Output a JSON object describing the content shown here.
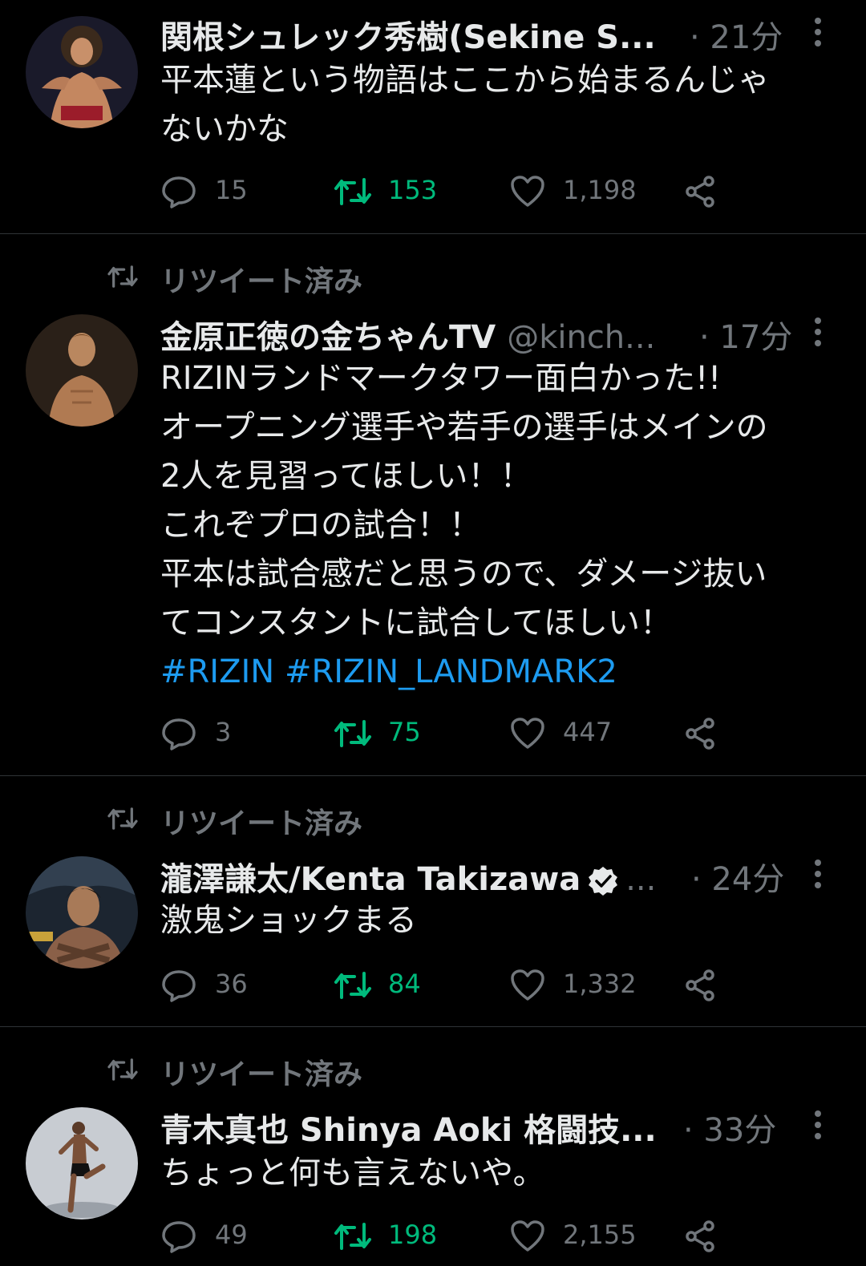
{
  "colors": {
    "background": "#000000",
    "text": "#e7e9ea",
    "muted": "#71767b",
    "retweet_green": "#00ba7c",
    "link_blue": "#1d9bf0",
    "divider": "#2f3336"
  },
  "icons": {
    "reply": "reply-icon",
    "retweet": "retweet-icon",
    "like": "heart-icon",
    "share": "share-icon",
    "more": "more-vertical-icon",
    "verified": "verified-badge-icon"
  },
  "tweets": [
    {
      "name": "関根シュレック秀樹(Sekine S...",
      "time": "· 21分",
      "lines": [
        "平本蓮という物語はここから始まるんじゃ",
        "ないかな"
      ],
      "replies": "15",
      "retweets": "153",
      "likes": "1,198"
    },
    {
      "retweet_label": "リツイート済み",
      "name": "金原正徳の金ちゃんTV",
      "handle": "@kinch...",
      "time": "· 17分",
      "lines": [
        "RIZINランドマークタワー面白かった!!",
        "オープニング選手や若手の選手はメインの",
        "2人を見習ってほしい！！",
        "これぞプロの試合！！",
        "平本は試合感だと思うので、ダメージ抜い",
        "てコンスタントに試合してほしい！"
      ],
      "hashtags": "#RIZIN #RIZIN_LANDMARK2",
      "replies": "3",
      "retweets": "75",
      "likes": "447"
    },
    {
      "retweet_label": "リツイート済み",
      "name": "瀧澤謙太/Kenta Takizawa",
      "name_ellipsis": "...",
      "time": "· 24分",
      "lines": [
        "激鬼ショックまる"
      ],
      "replies": "36",
      "retweets": "84",
      "likes": "1,332"
    },
    {
      "retweet_label": "リツイート済み",
      "name": "青木真也 Shinya Aoki 格闘技...",
      "time": "· 33分",
      "lines": [
        "ちょっと何も言えないや。"
      ],
      "replies": "49",
      "retweets": "198",
      "likes": "2,155"
    }
  ]
}
